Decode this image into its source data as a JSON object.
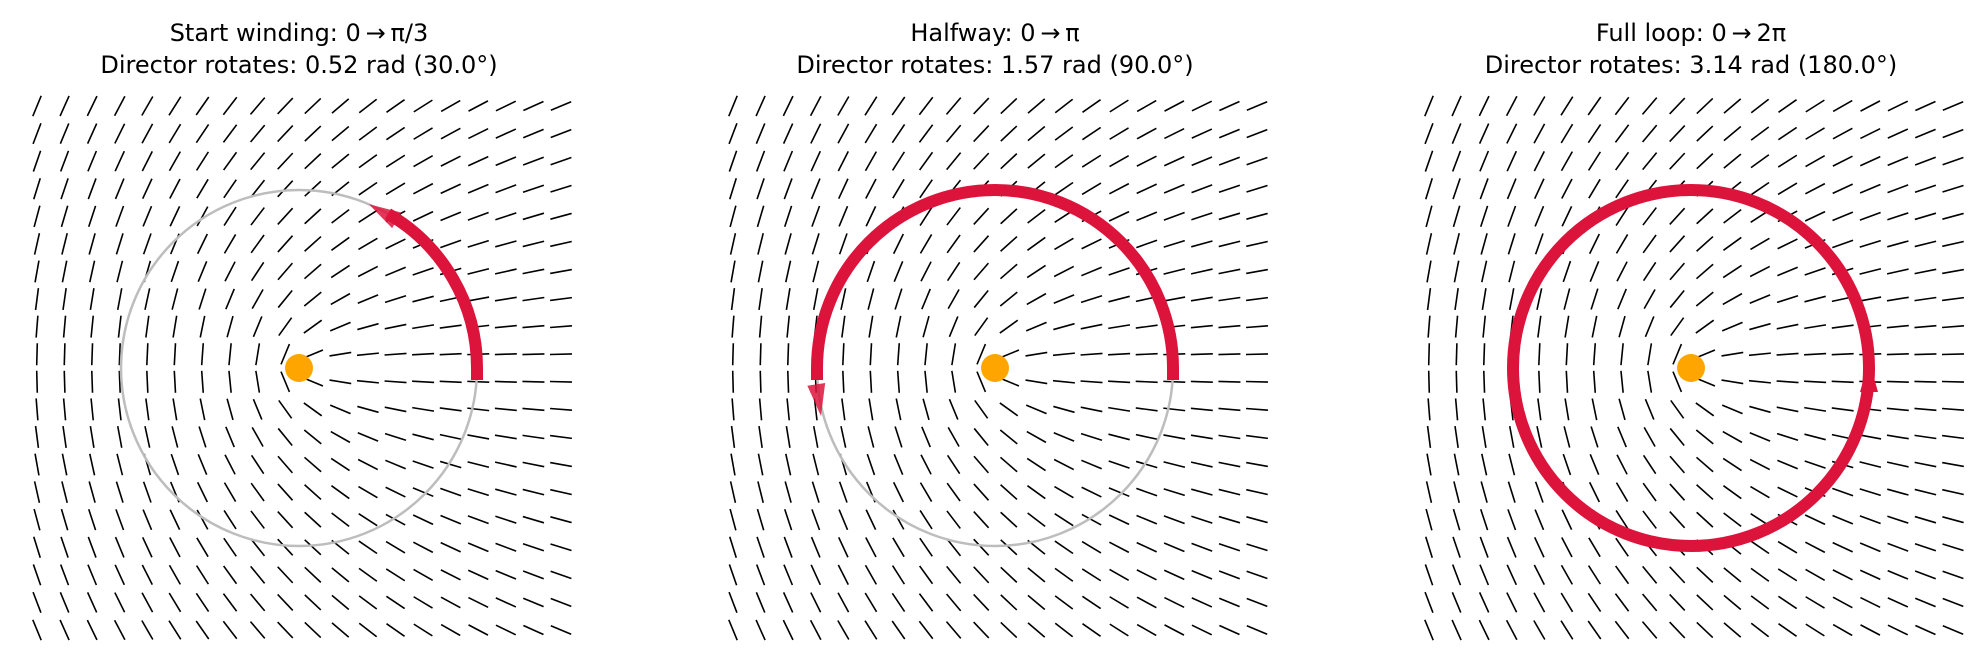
{
  "panels": [
    {
      "title_line1": "Start winding: 0 → π/3",
      "title_line2": "Director rotates: 0.52 rad (30.0°)",
      "loop_fraction": 0.3333,
      "director_rotation_rad": 0.52,
      "director_rotation_deg": 30.0
    },
    {
      "title_line1": "Halfway: 0 → π",
      "title_line2": "Director rotates: 1.57 rad (90.0°)",
      "loop_fraction": 1.0,
      "director_rotation_rad": 1.57,
      "director_rotation_deg": 90.0
    },
    {
      "title_line1": "Full loop: 0 → 2π",
      "title_line2": "Director rotates: 3.14 rad (180.0°)",
      "loop_fraction": 2.0,
      "director_rotation_rad": 3.14,
      "director_rotation_deg": 180.0
    }
  ],
  "topological_charge": 0.5,
  "grid_size": 20,
  "colors": {
    "director": "#000000",
    "guide_circle": "#bdbdbd",
    "winding_arc": "#dc143c",
    "defect_core": "#ffa500"
  }
}
